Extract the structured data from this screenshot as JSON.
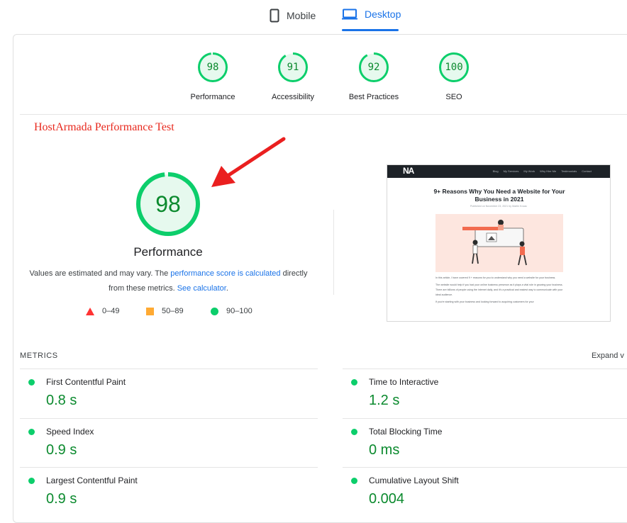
{
  "tabs": {
    "mobile_label": "Mobile",
    "desktop_label": "Desktop",
    "selected": "Desktop"
  },
  "summary_gauges": [
    {
      "score": "98",
      "label": "Performance"
    },
    {
      "score": "91",
      "label": "Accessibility"
    },
    {
      "score": "92",
      "label": "Best Practices"
    },
    {
      "score": "100",
      "label": "SEO"
    }
  ],
  "annotation": "HostArmada Performance Test",
  "performance": {
    "score": "98",
    "title": "Performance",
    "note_prefix": "Values are estimated and may vary. The ",
    "note_link1": "performance score is calculated",
    "note_middle": " directly from these metrics. ",
    "note_link2": "See calculator",
    "note_suffix": "."
  },
  "legend": [
    {
      "shape": "triangle",
      "range": "0–49",
      "color": "#ff3333"
    },
    {
      "shape": "square",
      "range": "50–89",
      "color": "#ffaa33"
    },
    {
      "shape": "circle",
      "range": "90–100",
      "color": "#0cce6b"
    }
  ],
  "screenshot_preview": {
    "logo": "NA",
    "nav_links": [
      "Blog",
      "My Services",
      "My Work",
      "Why Hire Me",
      "Testimonials",
      "Contact"
    ],
    "title": "9+ Reasons Why You Need a Website for Your Business in 2021",
    "byline": "Published on November 23, 2021 by Martin Kovac",
    "paragraphs": [
      "In this article, I have covered 9 + reasons for you to understand why you need a website for your business.",
      "The website would help if you had your online business presence as it plays a vital role in growing your business. There are billions of people using the internet daily, and it's a practical and easiest way to communicate with your ideal audience.",
      "If you're starting with your business and looking forward to acquiring customers for your"
    ]
  },
  "metrics_section": {
    "heading": "METRICS",
    "expand_label": "Expand v",
    "items": [
      {
        "name": "First Contentful Paint",
        "value": "0.8 s"
      },
      {
        "name": "Time to Interactive",
        "value": "1.2 s"
      },
      {
        "name": "Speed Index",
        "value": "0.9 s"
      },
      {
        "name": "Total Blocking Time",
        "value": "0 ms"
      },
      {
        "name": "Largest Contentful Paint",
        "value": "0.9 s"
      },
      {
        "name": "Cumulative Layout Shift",
        "value": "0.004"
      }
    ]
  },
  "colors": {
    "good": "#0cce6b",
    "good_text": "#0b8a2e",
    "accent": "#1a73e8",
    "annotation": "#e8281d"
  }
}
